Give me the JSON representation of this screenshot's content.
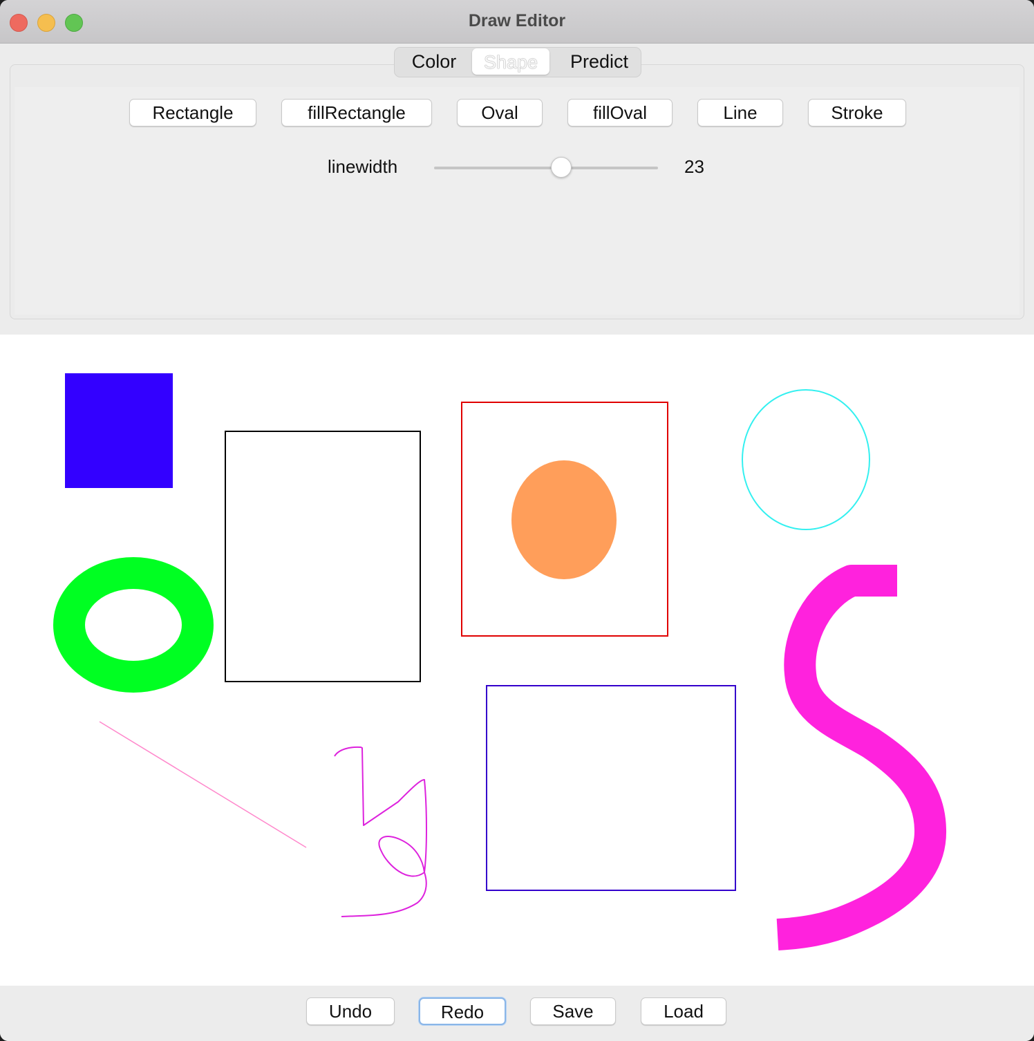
{
  "window": {
    "title": "Draw Editor"
  },
  "tabs": [
    {
      "label": "Color",
      "selected": false
    },
    {
      "label": "Shape",
      "selected": true
    },
    {
      "label": "Predict",
      "selected": false
    }
  ],
  "shape_buttons": {
    "rectangle": "Rectangle",
    "fill_rectangle": "fillRectangle",
    "oval": "Oval",
    "fill_oval": "fillOval",
    "line": "Line",
    "stroke": "Stroke"
  },
  "linewidth": {
    "label": "linewidth",
    "value": "23"
  },
  "actions": {
    "undo": "Undo",
    "redo": "Redo",
    "save": "Save",
    "load": "Load"
  },
  "drawing_colors": {
    "filled_rectangle": "#3300ff",
    "black_rectangle": "#000000",
    "red_rectangle": "#e00000",
    "orange_oval": "#ff9e5a",
    "cyan_oval": "#33f0f0",
    "green_ring": "#00ff22",
    "purple_rectangle": "#3300cc",
    "pink_line": "#ff88cc",
    "magenta_scribble": "#dd22dd",
    "magenta_stroke": "#ff22dd"
  }
}
